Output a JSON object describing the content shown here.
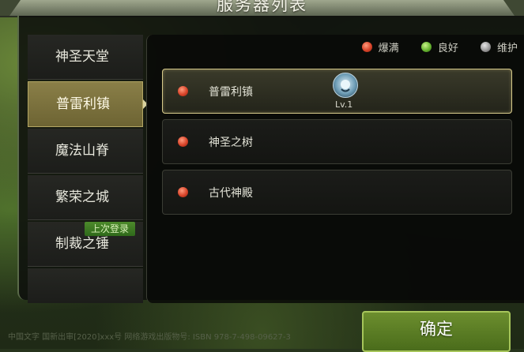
{
  "window": {
    "title": "服务器列表"
  },
  "tabs": [
    {
      "label": "神圣天堂",
      "active": false
    },
    {
      "label": "普雷利镇",
      "active": true
    },
    {
      "label": "魔法山脊",
      "active": false
    },
    {
      "label": "繁荣之城",
      "active": false
    },
    {
      "label": "制裁之锤",
      "active": false,
      "tag": "上次登录"
    }
  ],
  "legend": {
    "full": {
      "label": "爆满",
      "color": "#d8442a"
    },
    "good": {
      "label": "良好",
      "color": "#68b431"
    },
    "maintenance": {
      "label": "维护",
      "color": "#9a9a9a"
    }
  },
  "servers": [
    {
      "name": "普雷利镇",
      "status": "full",
      "selected": true,
      "level": "Lv.1"
    },
    {
      "name": "神圣之树",
      "status": "full",
      "selected": false
    },
    {
      "name": "古代神殿",
      "status": "full",
      "selected": false
    }
  ],
  "confirm_label": "确定",
  "footer": "中国文字 国新出审[2020]xxx号   网络游戏出版物号: ISBN 978-7-498-09627-3"
}
